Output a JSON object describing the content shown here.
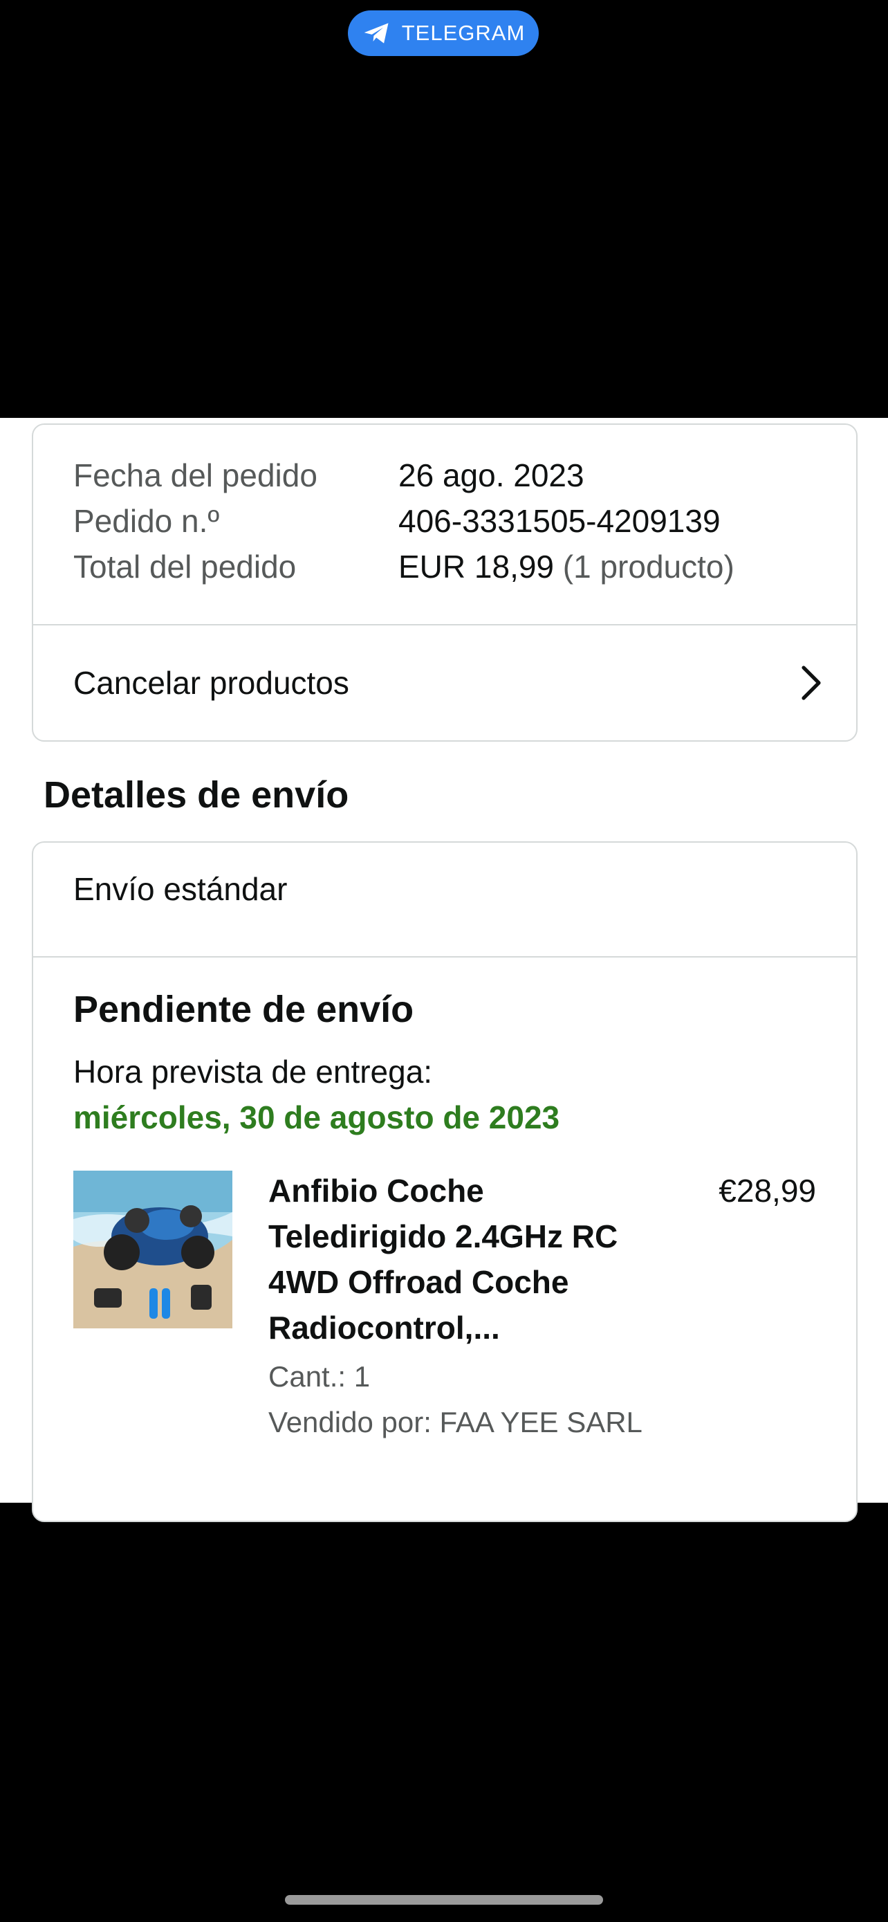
{
  "overlay": {
    "telegram_label": "TELEGRAM"
  },
  "order": {
    "date_label": "Fecha del pedido",
    "date_value": "26 ago. 2023",
    "number_label": "Pedido n.º",
    "number_value": "406-3331505-4209139",
    "total_label": "Total del pedido",
    "total_value": "EUR 18,99",
    "total_count": "(1 producto)",
    "cancel_label": "Cancelar productos"
  },
  "shipping": {
    "section_title": "Detalles de envío",
    "method": "Envío estándar",
    "status_title": "Pendiente de envío",
    "eta_label": "Hora prevista de entrega:",
    "eta_date": "miércoles, 30 de agosto de 2023"
  },
  "product": {
    "title": "Anfibio Coche Teledirigido 2.4GHz RC 4WD Offroad Coche Radiocontrol,...",
    "price": "€28,99",
    "quantity": "Cant.: 1",
    "seller": "Vendido por: FAA YEE SARL",
    "image_icon": "product-photo"
  },
  "colors": {
    "telegram_blue": "#2f82f0",
    "eta_green": "#2e7d1f",
    "muted_text": "#565959",
    "border": "#d5d9d9"
  }
}
